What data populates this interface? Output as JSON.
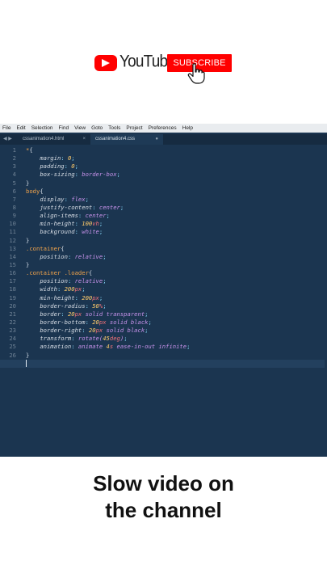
{
  "banner": {
    "wordmark": "YouTube",
    "subscribe_label": "SUBSCRIBE",
    "brand_color": "#ff0000",
    "icon": "youtube-logo-icon",
    "cursor_icon": "hand-pointer-icon"
  },
  "menubar": {
    "items": [
      "File",
      "Edit",
      "Selection",
      "Find",
      "View",
      "Goto",
      "Tools",
      "Project",
      "Preferences",
      "Help"
    ]
  },
  "tabs": {
    "nav_label": "◀ ▶",
    "items": [
      {
        "label": "cssanimation4.html",
        "close": "×"
      },
      {
        "label": "cssanimation4.css",
        "close": "●"
      }
    ]
  },
  "editor": {
    "line_numbers": [
      "1",
      "2",
      "3",
      "4",
      "5",
      "6",
      "7",
      "8",
      "9",
      "10",
      "11",
      "12",
      "13",
      "14",
      "15",
      "16",
      "17",
      "18",
      "19",
      "20",
      "21",
      "22",
      "23",
      "24",
      "25",
      "26",
      "27"
    ],
    "active_line": 27,
    "theme_background": "#1b3550"
  },
  "caption": {
    "line1": "Slow video on",
    "line2": "the channel"
  }
}
